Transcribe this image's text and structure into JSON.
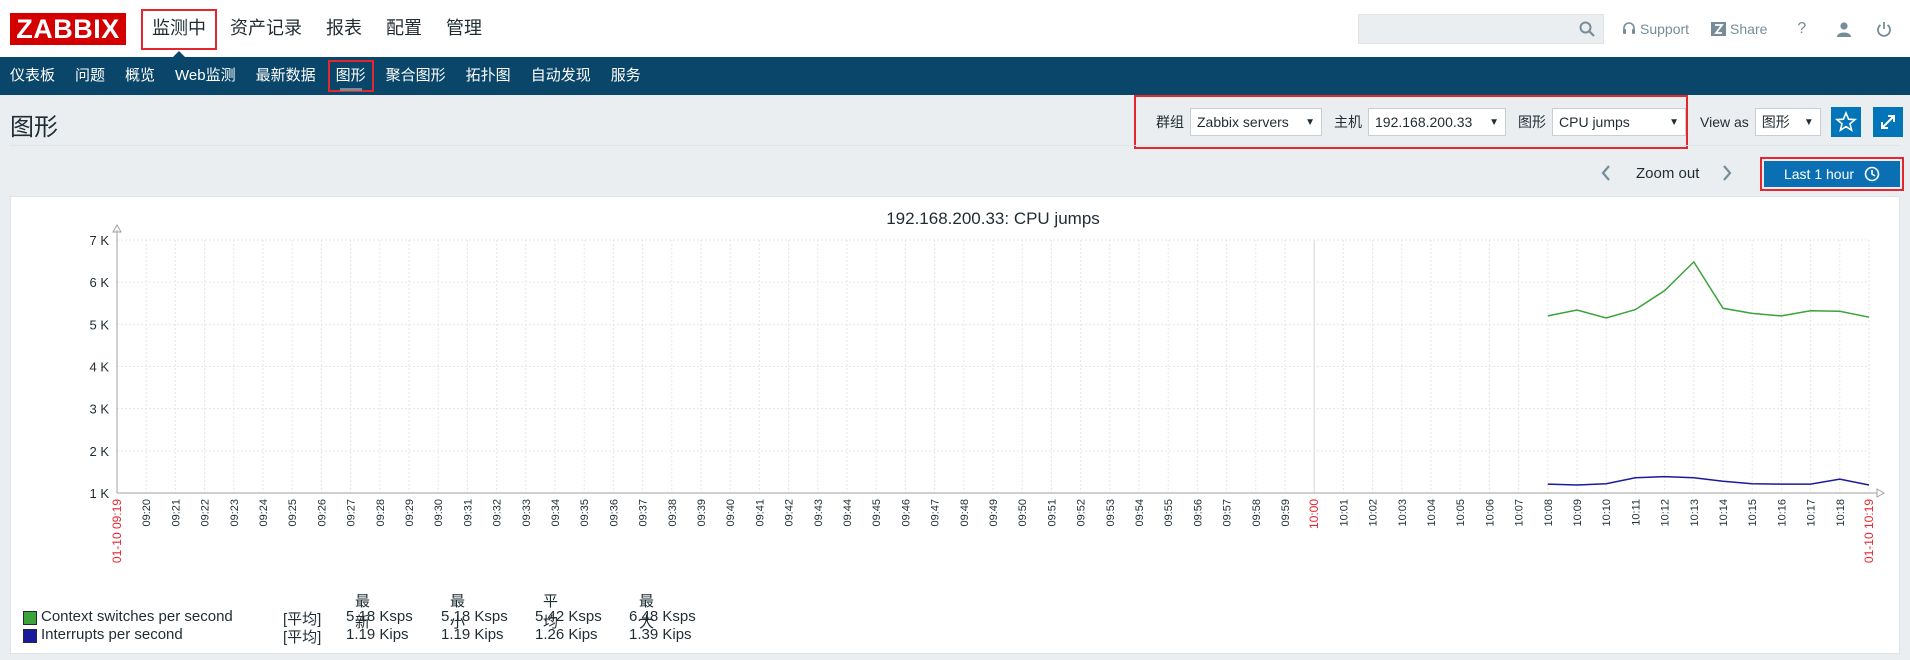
{
  "logo": "ZABBIX",
  "top_menu": [
    "监测中",
    "资产记录",
    "报表",
    "配置",
    "管理"
  ],
  "top_links": {
    "support": "Support",
    "share": "Share",
    "help": "?"
  },
  "sub_menu": [
    "仪表板",
    "问题",
    "概览",
    "Web监测",
    "最新数据",
    "图形",
    "聚合图形",
    "拓扑图",
    "自动发现",
    "服务"
  ],
  "page_title": "图形",
  "filters": {
    "group_label": "群组",
    "group_value": "Zabbix servers",
    "host_label": "主机",
    "host_value": "192.168.200.33",
    "graph_label": "图形",
    "graph_value": "CPU jumps",
    "view_as_label": "View as",
    "view_as_value": "图形"
  },
  "time": {
    "zoom_out": "Zoom out",
    "range": "Last 1 hour"
  },
  "colors": {
    "accent": "#0a466a",
    "red_highlight": "#e4262f",
    "series1": "#3aa33a",
    "series2": "#1a1a9c"
  },
  "chart_data": {
    "type": "line",
    "title": "192.168.200.33: CPU jumps",
    "y_ticks": [
      "7 K",
      "6 K",
      "5 K",
      "4 K",
      "3 K",
      "2 K",
      "1 K"
    ],
    "ylim": [
      1000,
      7000
    ],
    "x_ticks": [
      "09:20",
      "09:21",
      "09:22",
      "09:23",
      "09:24",
      "09:25",
      "09:26",
      "09:27",
      "09:28",
      "09:29",
      "09:30",
      "09:31",
      "09:32",
      "09:33",
      "09:34",
      "09:35",
      "09:36",
      "09:37",
      "09:38",
      "09:39",
      "09:40",
      "09:41",
      "09:42",
      "09:43",
      "09:44",
      "09:45",
      "09:46",
      "09:47",
      "09:48",
      "09:49",
      "09:50",
      "09:51",
      "09:52",
      "09:53",
      "09:54",
      "09:55",
      "09:56",
      "09:57",
      "09:58",
      "09:59",
      "10:00",
      "10:01",
      "10:02",
      "10:03",
      "10:04",
      "10:05",
      "10:06",
      "10:07",
      "10:08",
      "10:09",
      "10:10",
      "10:11",
      "10:12",
      "10:13",
      "10:14",
      "10:15",
      "10:16",
      "10:17",
      "10:18"
    ],
    "x_start_label": "01-10 09:19",
    "x_end_label": "01-10 10:19",
    "x_mid_label": "10:00",
    "x_points": [
      "10:08",
      "10:09",
      "10:10",
      "10:11",
      "10:12",
      "10:13",
      "10:14",
      "10:15",
      "10:16",
      "10:17",
      "10:18",
      "10:19"
    ],
    "series": [
      {
        "name": "Context switches per second",
        "color": "#3aa33a",
        "values": [
          5200,
          5340,
          5150,
          5350,
          5800,
          6480,
          5380,
          5260,
          5200,
          5320,
          5310,
          5170
        ]
      },
      {
        "name": "Interrupts per second",
        "color": "#1a1a9c",
        "values": [
          1210,
          1190,
          1220,
          1360,
          1390,
          1360,
          1280,
          1220,
          1210,
          1210,
          1330,
          1190
        ]
      }
    ],
    "legend_headers": [
      "最新",
      "最小",
      "平均",
      "最大"
    ],
    "legend_rows": [
      {
        "name": "Context switches per second",
        "func": "[平均]",
        "last": "5.18 Ksps",
        "min": "5.18 Ksps",
        "avg": "5.42 Ksps",
        "max": "6.48 Ksps"
      },
      {
        "name": "Interrupts per second",
        "func": "[平均]",
        "last": "1.19 Kips",
        "min": "1.19 Kips",
        "avg": "1.26 Kips",
        "max": "1.39 Kips"
      }
    ]
  }
}
